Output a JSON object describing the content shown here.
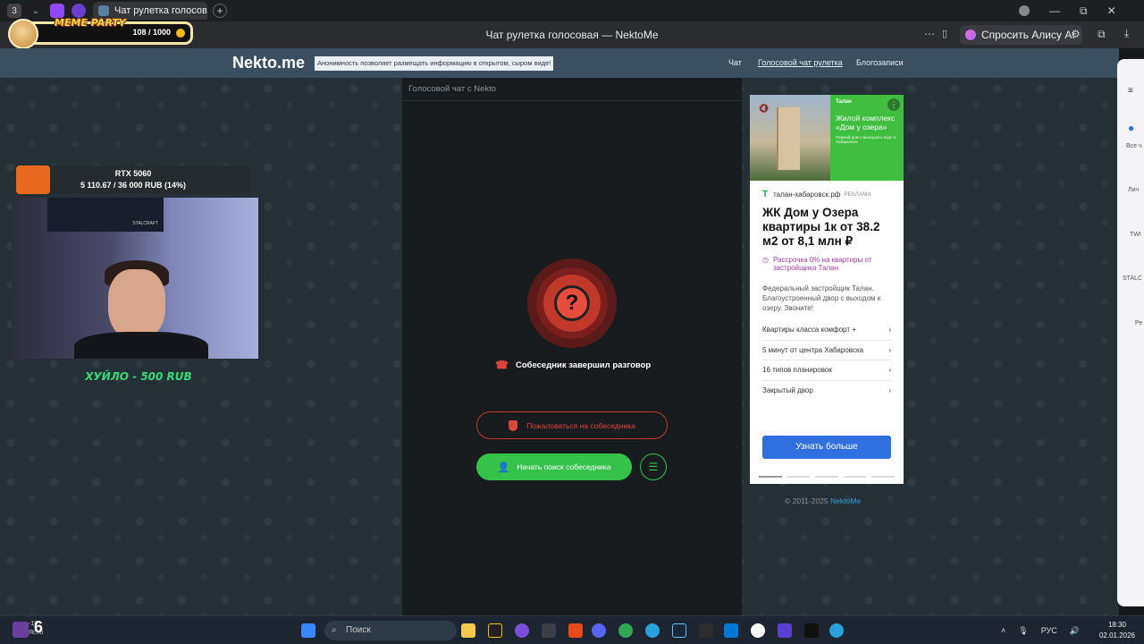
{
  "browser": {
    "tab_count": "3",
    "tab_title": "Чат рулетка голосова",
    "page_title": "Чат рулетка голосовая — NektoMe",
    "alice_label": "Спросить Алису AI"
  },
  "meme_party": {
    "title": "MEME PARTY",
    "counter": "108 / 1000"
  },
  "site": {
    "logo": "Nekto.me",
    "notice": "Анонимность позволяет размещать информацию в открытом, сыром виде!",
    "nav": [
      "Чат",
      "Голосовой чат рулетка",
      "Блогозаписи"
    ]
  },
  "chat": {
    "header": "Голосовой чат с Nekto",
    "status": "Собеседник завершил разговор",
    "report_label": "Пожаловаться на собеседника",
    "search_label": "Начать поиск собеседника"
  },
  "ad": {
    "brand": "Талан",
    "image_heading": "Жилой комплекс «Дом у озера»",
    "image_sub": "Первый дом с выходом к воде в Хабаровске",
    "domain": "талан-хабаровск.рф",
    "ad_tag": "РЕКЛАМА",
    "title": "ЖК Дом у Озера квартиры 1к от 38.2 м2 от 8,1 млн ₽",
    "promo": "Рассрочка 0% на квартиры от застройщика Талан",
    "description": "Федеральный застройщик Талан. Благоустроенный двор с выходом к озеру. Звоните!",
    "links": [
      "Квартиры класса комфорт +",
      "5 минут от центра Хабаровска",
      "16 типов планировок",
      "Закрытый двор"
    ],
    "cta": "Узнать больше"
  },
  "footer": {
    "copyright": "© 2011-2025",
    "brand_link": "NektoMe"
  },
  "stream": {
    "goal_title": "RTX 5060",
    "goal_progress": "5 110.67 / 36 000 RUB (14%)",
    "goal_fraction": 0.14,
    "poster_text": "STALCRAFT",
    "donation": "ХУЙЛО - 500 RUB"
  },
  "sidebar": {
    "items": [
      "Все ч",
      "Лич",
      "TWI",
      "STALC",
      "Ре"
    ]
  },
  "taskbar": {
    "weather_temp": "-19",
    "weather_desc": "Ясно",
    "widget_number": "6",
    "search_placeholder": "Поиск",
    "language": "РУС",
    "time": "18:30",
    "date": "02.01.2026"
  },
  "colors": {
    "accent_green": "#35c24a",
    "danger_red": "#c0392b",
    "header_blue": "#3b4f5f",
    "ad_button": "#2f6fe0"
  }
}
